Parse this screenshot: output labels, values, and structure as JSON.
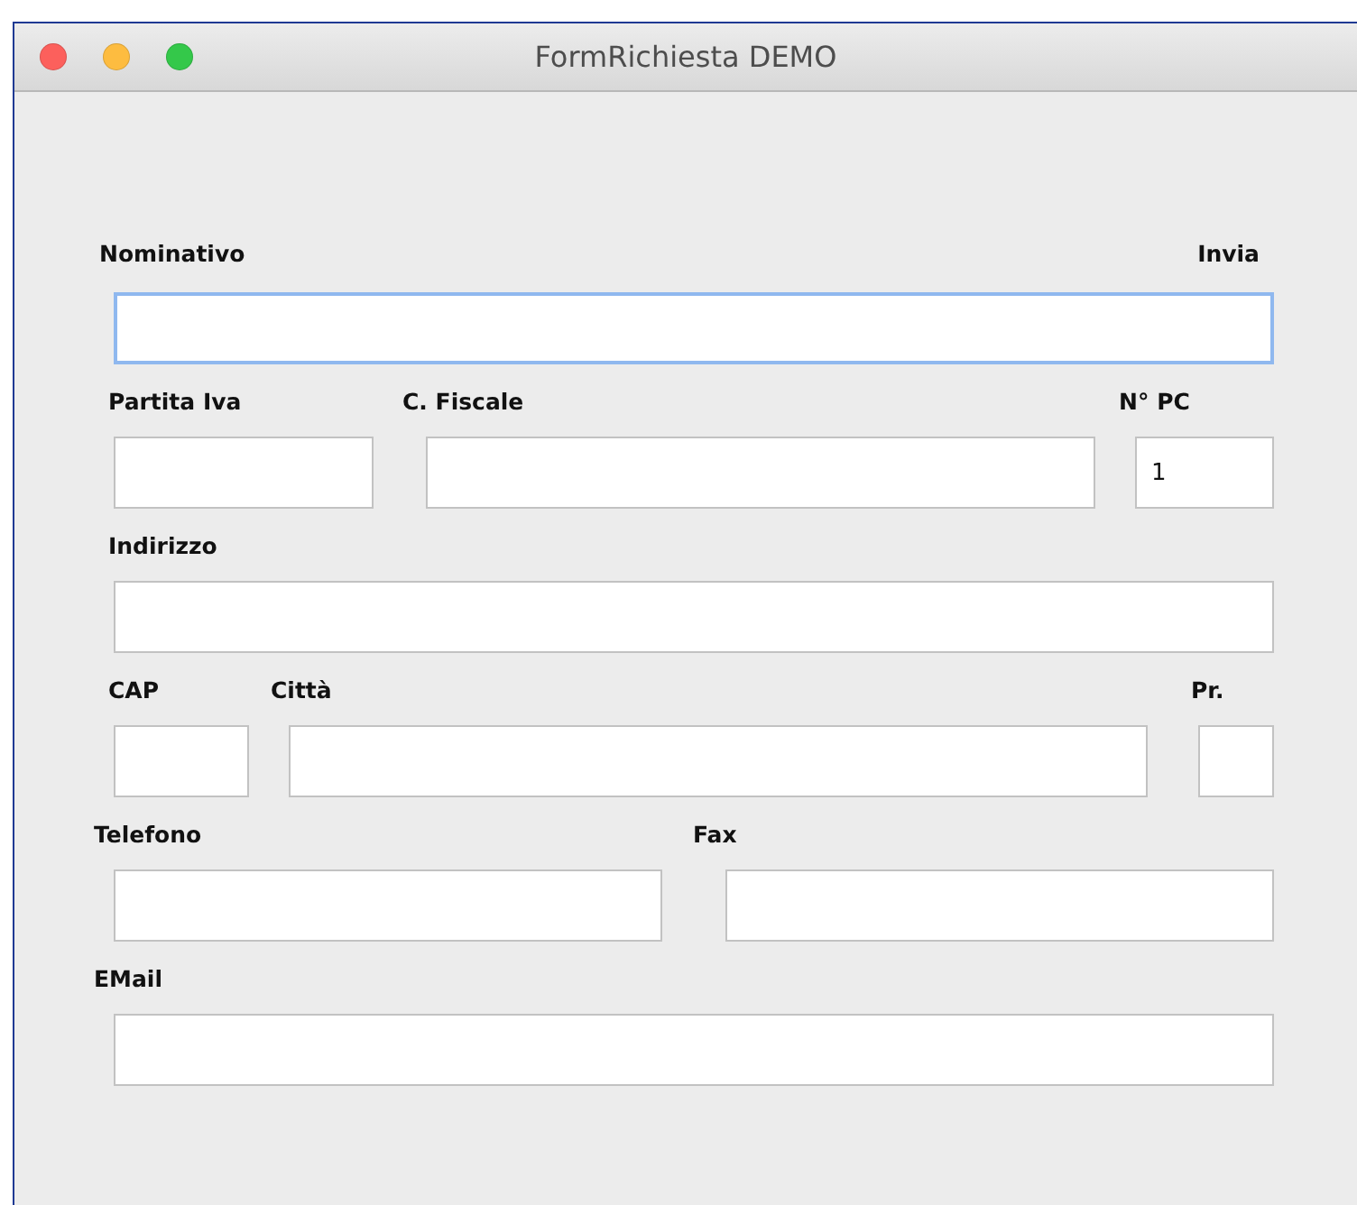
{
  "window": {
    "title": "FormRichiesta DEMO"
  },
  "rows": [
    {
      "aside": "Invia",
      "fields": [
        {
          "label": "Nominativo",
          "focused": true
        }
      ]
    },
    {
      "fields": [
        {
          "label": "Partita Iva",
          "focused": false
        },
        {
          "label": "C. Fiscale",
          "focused": false
        },
        {
          "label": "N° PC",
          "value": "1",
          "focused": false
        }
      ]
    },
    {
      "fields": [
        {
          "label": "Indirizzo",
          "focused": false
        }
      ]
    },
    {
      "fields": [
        {
          "label": "CAP",
          "focused": false
        },
        {
          "label": "Città",
          "focused": false
        },
        {
          "label": "Pr.",
          "focused": false
        }
      ]
    },
    {
      "fields": [
        {
          "label": "Telefono",
          "focused": false
        },
        {
          "label": "Fax",
          "focused": false
        }
      ]
    },
    {
      "fields": [
        {
          "label": "EMail",
          "focused": false
        }
      ]
    }
  ]
}
